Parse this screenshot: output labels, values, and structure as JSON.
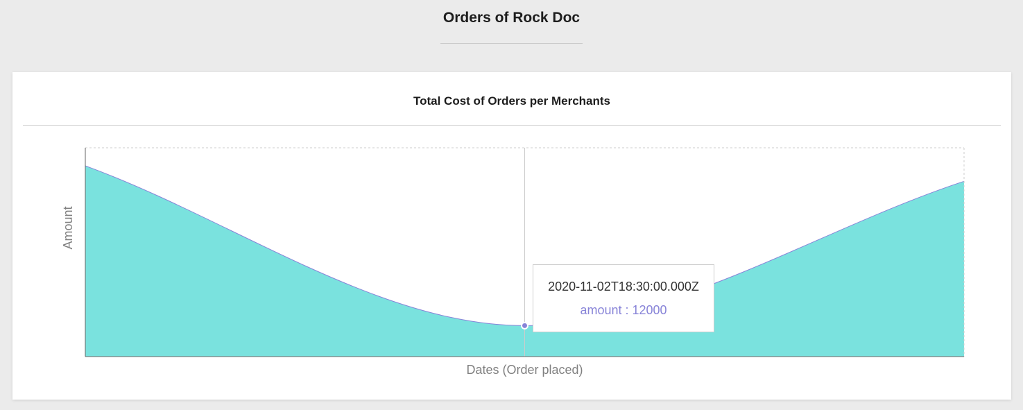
{
  "page": {
    "title": "Orders of Rock Doc"
  },
  "card": {
    "title": "Total Cost of Orders per Merchants"
  },
  "chart_data": {
    "type": "area",
    "title": "Total Cost of Orders per Merchants",
    "xlabel": "Dates (Order placed)",
    "ylabel": "Amount",
    "x": [
      "",
      "2020-11-02T18:30:00.000Z",
      ""
    ],
    "series": [
      {
        "name": "amount",
        "values": [
          74000,
          12000,
          68000
        ]
      }
    ],
    "ylim": [
      0,
      81000
    ],
    "grid": false,
    "area_fill": "#7ae2de",
    "line_color": "#8884d8",
    "tooltip": {
      "label": "2020-11-02T18:30:00.000Z",
      "value_text": "amount : 12000",
      "active_index": 1
    }
  },
  "colors": {
    "background": "#ebebeb",
    "card": "#ffffff",
    "area": "#7ae2de",
    "line": "#8884d8",
    "axis": "#666666",
    "axis_label": "#808080"
  }
}
